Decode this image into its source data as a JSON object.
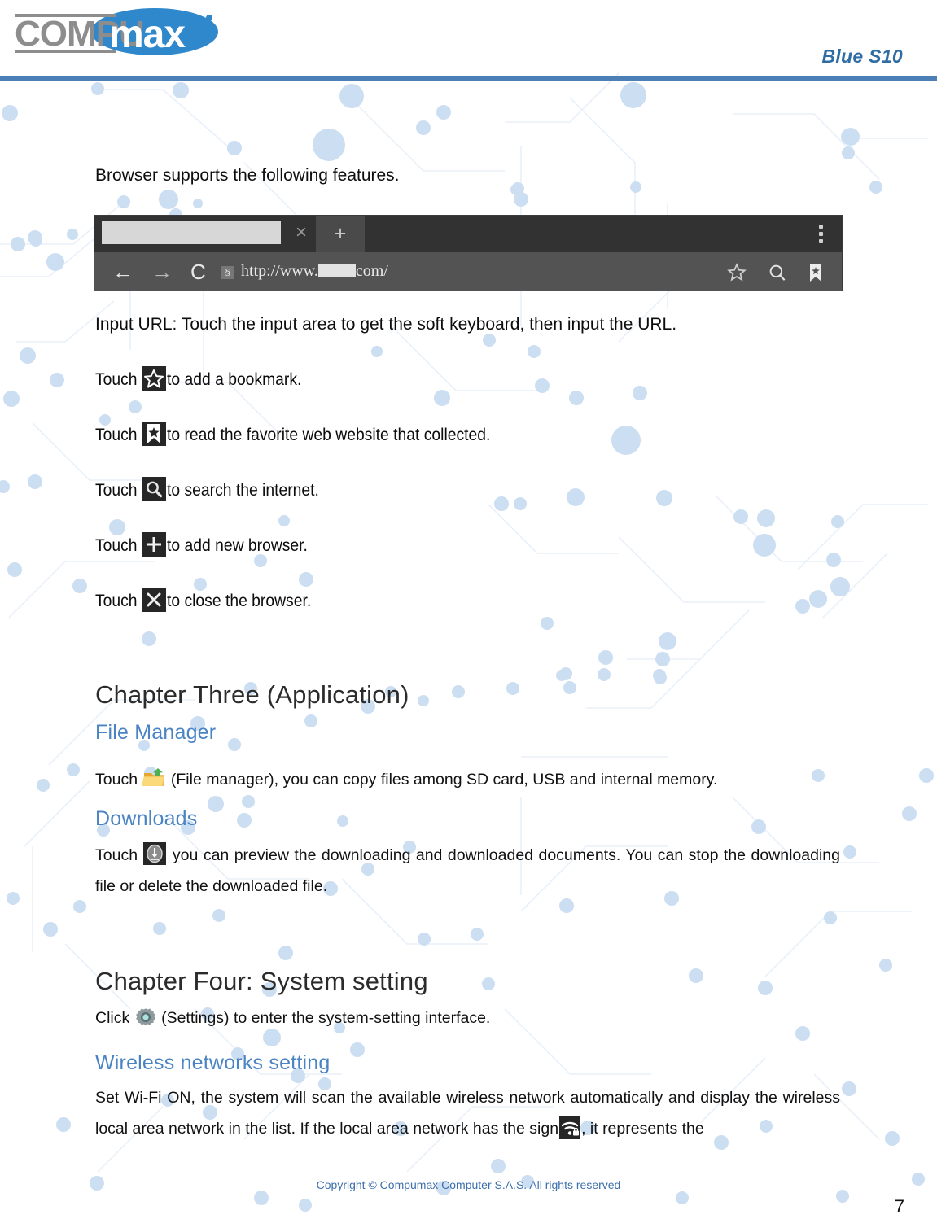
{
  "header": {
    "logo_text_gray": "COMPU",
    "logo_text_white": "max",
    "model": "Blue S10"
  },
  "body": {
    "intro": "Browser supports the following features.",
    "input_url_line": "Input URL: Touch the input area to get the soft keyboard, then input the URL.",
    "touch_lines": [
      {
        "prefix": "Touch ",
        "icon": "star-icon",
        "suffix": "to add a bookmark."
      },
      {
        "prefix": "Touch ",
        "icon": "bookmark-star-icon",
        "suffix": "to read the favorite web website that collected."
      },
      {
        "prefix": "Touch ",
        "icon": "search-icon",
        "suffix": "to search the internet."
      },
      {
        "prefix": "Touch ",
        "icon": "plus-icon",
        "suffix": "to add new browser."
      },
      {
        "prefix": "Touch ",
        "icon": "close-icon",
        "suffix": "to close the browser."
      }
    ]
  },
  "browser_screenshot": {
    "tab_close_label": "×",
    "new_tab_label": "+",
    "back_label": "←",
    "forward_label": "→",
    "reload_label": "C",
    "lock_label": "§",
    "url_before": "http://www.",
    "url_after": "com/",
    "star_label": "star-icon",
    "search_label": "search-icon",
    "bookmark_label": "bookmark-icon"
  },
  "chapter_three": {
    "title": "Chapter Three (Application)",
    "file_manager": {
      "heading": "File Manager",
      "prefix": "Touch ",
      "icon": "file-manager-folder-icon",
      "suffix": " (File manager), you can copy files among SD card, USB and internal memory."
    },
    "downloads": {
      "heading": "Downloads",
      "prefix": "Touch ",
      "icon": "download-icon",
      "suffix": " you can preview the downloading and downloaded documents. You can stop the downloading file or delete the downloaded file."
    }
  },
  "chapter_four": {
    "title": "Chapter Four: System setting",
    "settings_line": {
      "prefix": "Click ",
      "icon": "settings-gear-icon",
      "suffix": " (Settings) to enter the system-setting interface."
    },
    "wireless": {
      "heading": "Wireless networks setting",
      "text_part1": "Set Wi-Fi ON, the system will scan the available wireless network automatically and display the wireless local area network in the list. If the local area network has the sign",
      "icon": "wifi-lock-icon",
      "text_part2": ", it represents the"
    }
  },
  "footer": {
    "copyright": "Copyright © Compumax Computer S.A.S. All rights reserved",
    "page_number": "7"
  },
  "colors": {
    "brand_blue": "#4b7fb5",
    "heading_blue": "#4a84c4",
    "model_blue": "#2e6da4",
    "watermark_dot": "#ccdef1",
    "icon_dark": "#262626"
  }
}
